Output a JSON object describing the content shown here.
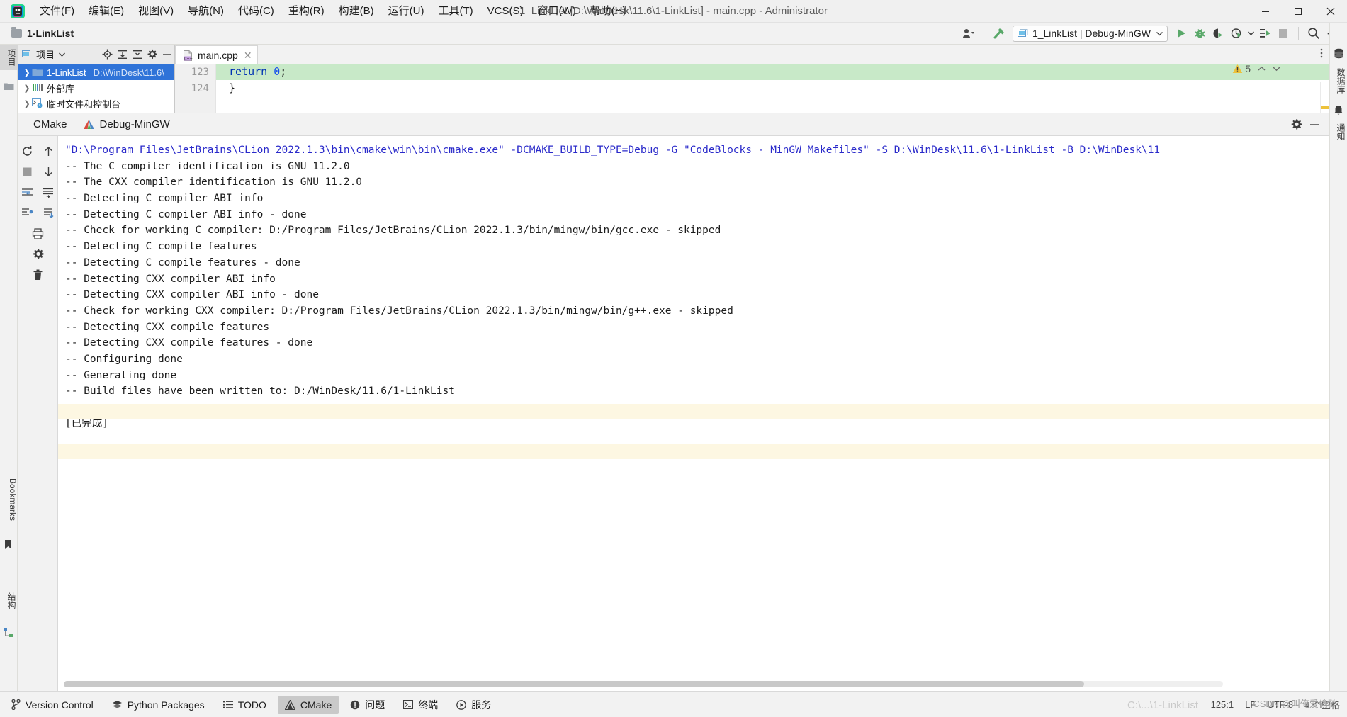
{
  "titlebar": {
    "window_title": "1_LinkList [D:\\WinDesk\\11.6\\1-LinkList] - main.cpp - Administrator",
    "menu": [
      {
        "label": "文件(F)"
      },
      {
        "label": "编辑(E)"
      },
      {
        "label": "视图(V)"
      },
      {
        "label": "导航(N)"
      },
      {
        "label": "代码(C)"
      },
      {
        "label": "重构(R)"
      },
      {
        "label": "构建(B)"
      },
      {
        "label": "运行(U)"
      },
      {
        "label": "工具(T)"
      },
      {
        "label": "VCS(S)"
      },
      {
        "label": "窗口(W)"
      },
      {
        "label": "帮助(H)"
      }
    ],
    "controls": {
      "minimize": "–",
      "maximize": "□",
      "close": "✕"
    }
  },
  "toolbar": {
    "breadcrumb": "1-LinkList",
    "run_config": "1_LinkList | Debug-MinGW",
    "icons": [
      "user-avatar-icon",
      "chevron-down-icon",
      "build-hammer-icon",
      "run-configuration-icon",
      "run-icon",
      "debug-icon",
      "run-with-coverage-icon",
      "profiler-icon",
      "chevron-down-icon",
      "attach-to-process-icon",
      "stop-icon",
      "search-icon",
      "settings-gear-icon"
    ]
  },
  "left_strip": {
    "tabs": [
      {
        "label": "项目",
        "active": true
      },
      {
        "label": "Bookmarks",
        "active": false
      },
      {
        "label": "结构",
        "active": false
      }
    ]
  },
  "right_strip": {
    "tabs": [
      {
        "label": "数据库"
      },
      {
        "label": "通知"
      }
    ]
  },
  "project_panel": {
    "title": "项目",
    "header_icons": [
      "project-view-icon",
      "chevron-down-icon",
      "locate-icon",
      "expand-all-icon",
      "collapse-all-icon",
      "settings-gear-icon",
      "hide-icon"
    ],
    "tree": [
      {
        "label": "1-LinkList",
        "path": "D:\\WinDesk\\11.6\\",
        "icon": "folder-icon",
        "selected": true,
        "expanded": false
      },
      {
        "label": "外部库",
        "path": "",
        "icon": "library-icon",
        "selected": false,
        "expanded": false
      },
      {
        "label": "临时文件和控制台",
        "path": "",
        "icon": "scratch-console-icon",
        "selected": false,
        "expanded": false
      }
    ]
  },
  "editor": {
    "tab": {
      "name": "main.cpp",
      "icon": "cpp-file-icon",
      "close": "✕"
    },
    "lines": [
      {
        "number": "123",
        "text": "return 0;",
        "highlighted": true
      },
      {
        "number": "124",
        "text": "}",
        "highlighted": false
      }
    ],
    "inspection": {
      "icon": "warning-triangle-icon",
      "count": "5",
      "up": "⌃",
      "down": "⌄"
    },
    "more_icon": "more-vertical-icon"
  },
  "cmake_window": {
    "title": "CMake",
    "tab": {
      "label": "Debug-MinGW",
      "icon": "cmake-triangle-icon"
    },
    "header_icons": [
      "settings-gear-icon",
      "hide-icon"
    ],
    "side_buttons": [
      "rerun-cmake-icon",
      "scroll-up-icon",
      "stop-icon",
      "scroll-down-icon",
      "toggle-soft-wrap-icon",
      "use-soft-wraps-icon",
      "scroll-to-end-icon",
      "print-icon",
      "settings-gear-icon",
      "clear-all-trash-icon"
    ],
    "console_lines": [
      {
        "text": "\"D:\\Program Files\\JetBrains\\CLion 2022.1.3\\bin\\cmake\\win\\bin\\cmake.exe\" -DCMAKE_BUILD_TYPE=Debug -G \"CodeBlocks - MinGW Makefiles\" -S D:\\WinDesk\\11.6\\1-LinkList -B D:\\WinDesk\\11",
        "style": "blue"
      },
      {
        "text": "-- The C compiler identification is GNU 11.2.0",
        "style": "dark"
      },
      {
        "text": "-- The CXX compiler identification is GNU 11.2.0",
        "style": "dark"
      },
      {
        "text": "-- Detecting C compiler ABI info",
        "style": "dark"
      },
      {
        "text": "-- Detecting C compiler ABI info - done",
        "style": "dark"
      },
      {
        "text": "-- Check for working C compiler: D:/Program Files/JetBrains/CLion 2022.1.3/bin/mingw/bin/gcc.exe - skipped",
        "style": "dark"
      },
      {
        "text": "-- Detecting C compile features",
        "style": "dark"
      },
      {
        "text": "-- Detecting C compile features - done",
        "style": "dark"
      },
      {
        "text": "-- Detecting CXX compiler ABI info",
        "style": "dark"
      },
      {
        "text": "-- Detecting CXX compiler ABI info - done",
        "style": "dark"
      },
      {
        "text": "-- Check for working CXX compiler: D:/Program Files/JetBrains/CLion 2022.1.3/bin/mingw/bin/g++.exe - skipped",
        "style": "dark"
      },
      {
        "text": "-- Detecting CXX compile features",
        "style": "dark"
      },
      {
        "text": "-- Detecting CXX compile features - done",
        "style": "dark"
      },
      {
        "text": "-- Configuring done",
        "style": "dark"
      },
      {
        "text": "-- Generating done",
        "style": "dark"
      },
      {
        "text": "-- Build files have been written to: D:/WinDesk/11.6/1-LinkList",
        "style": "dark"
      },
      {
        "text": "",
        "style": "dark"
      },
      {
        "text": "[已完成]",
        "style": "dark"
      }
    ]
  },
  "bottom_bar": {
    "tabs": [
      {
        "label": "Version Control",
        "icon": "branch-icon",
        "active": false
      },
      {
        "label": "Python Packages",
        "icon": "packages-icon",
        "active": false
      },
      {
        "label": "TODO",
        "icon": "list-icon",
        "active": false
      },
      {
        "label": "CMake",
        "icon": "cmake-triangle-icon",
        "active": true
      },
      {
        "label": "问题",
        "icon": "exclamation-circle-icon",
        "active": false
      },
      {
        "label": "终端",
        "icon": "terminal-icon",
        "active": false
      },
      {
        "label": "服务",
        "icon": "play-circle-icon",
        "active": false
      }
    ],
    "status": [
      "125:1",
      "LF",
      "UTF-8",
      "4 个空格"
    ],
    "ghost_title": "C:\\...\\1-LinkList",
    "watermark": "CSDN @叫俺爱偷孙"
  },
  "colors": {
    "accent_blue": "#2f73d8",
    "console_blue": "#2a2aca",
    "highlight_green": "#c8e9c8",
    "highlight_band": "#fdf7e2",
    "warning_yellow": "#edc23a",
    "run_green": "#59a869"
  }
}
